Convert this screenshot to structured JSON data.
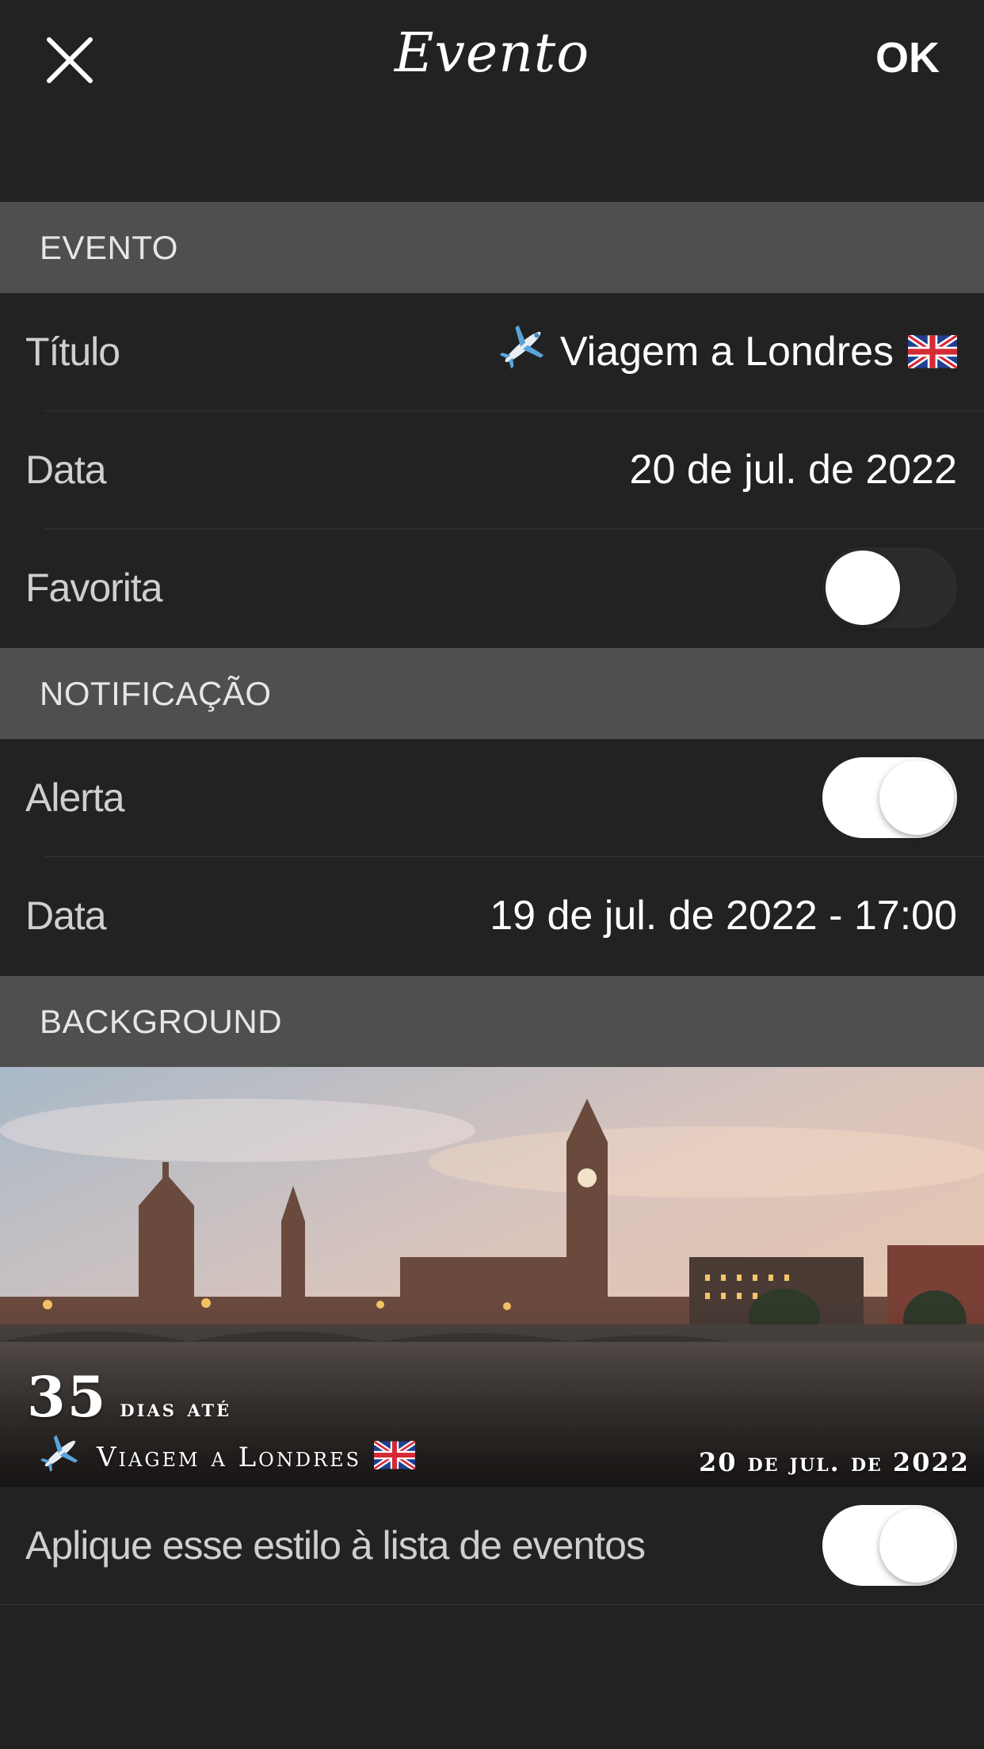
{
  "nav": {
    "title": "Evento",
    "ok_label": "OK",
    "close_icon": "close-icon"
  },
  "sections": {
    "evento": "EVENTO",
    "notificacao": "NOTIFICAÇÃO",
    "background": "BACKGROUND"
  },
  "event": {
    "title_label": "Título",
    "title_value": "Viagem a Londres",
    "title_prefix_icon": "airplane-icon",
    "title_suffix_icon": "uk-flag-icon",
    "date_label": "Data",
    "date_value": "20 de jul. de 2022",
    "favorite_label": "Favorita",
    "favorite_on": false
  },
  "notification": {
    "alert_label": "Alerta",
    "alert_on": true,
    "date_label": "Data",
    "date_value": "19 de jul. de 2022 - 17:00"
  },
  "background": {
    "days_count": "35",
    "days_text": "dias até",
    "event_title": "Viagem a Londres",
    "event_date": "20 de jul. de 2022",
    "apply_label": "Aplique esse estilo à lista de eventos",
    "apply_on": true
  },
  "colors": {
    "page_bg": "#222222",
    "section_bg": "#4f4f4f",
    "toggle_on": "#ffffff",
    "toggle_off": "#2c2c2c"
  }
}
